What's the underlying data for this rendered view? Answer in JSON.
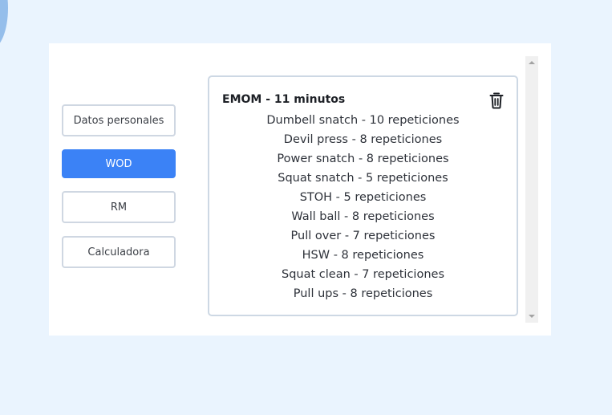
{
  "nav": {
    "items": [
      {
        "label": "Datos personales",
        "active": false
      },
      {
        "label": "WOD",
        "active": true
      },
      {
        "label": "RM",
        "active": false
      },
      {
        "label": "Calculadora",
        "active": false
      }
    ]
  },
  "wod": {
    "title": "EMOM - 11 minutos",
    "delete_icon": "trash-icon",
    "exercises": [
      "Dumbell snatch - 10 repeticiones",
      "Devil press - 8 repeticiones",
      "Power snatch - 8 repeticiones",
      "Squat snatch - 5 repeticiones",
      "STOH - 5 repeticiones",
      "Wall ball - 8 repeticiones",
      "Pull over - 7 repeticiones",
      "HSW - 8 repeticiones",
      "Squat clean - 7 repeticiones",
      "Pull ups - 8 repeticiones"
    ]
  },
  "colors": {
    "accent": "#3b82f6",
    "page_background": "#eaf4fe",
    "border": "#cfd7e2"
  }
}
